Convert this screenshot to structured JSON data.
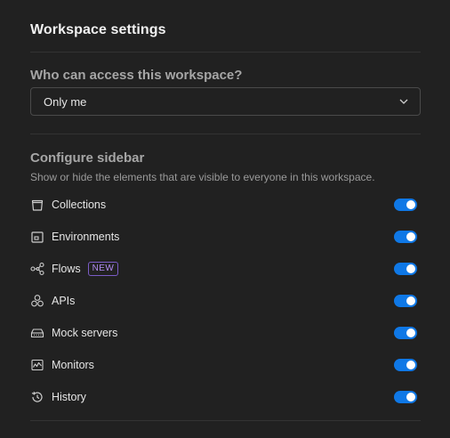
{
  "title": "Workspace settings",
  "access": {
    "heading": "Who can access this workspace?",
    "selected": "Only me"
  },
  "sidebar": {
    "heading": "Configure sidebar",
    "description": "Show or hide the elements that are visible to everyone in this workspace.",
    "items": [
      {
        "label": "Collections",
        "icon": "collections-icon",
        "enabled": true
      },
      {
        "label": "Environments",
        "icon": "environments-icon",
        "enabled": true
      },
      {
        "label": "Flows",
        "icon": "flows-icon",
        "badge": "NEW",
        "enabled": true
      },
      {
        "label": "APIs",
        "icon": "apis-icon",
        "enabled": true
      },
      {
        "label": "Mock servers",
        "icon": "mock-servers-icon",
        "enabled": true
      },
      {
        "label": "Monitors",
        "icon": "monitors-icon",
        "enabled": true
      },
      {
        "label": "History",
        "icon": "history-icon",
        "enabled": true
      }
    ]
  },
  "colors": {
    "background": "#212121",
    "toggle_on": "#0f78e6",
    "badge": "#b28cf2"
  }
}
